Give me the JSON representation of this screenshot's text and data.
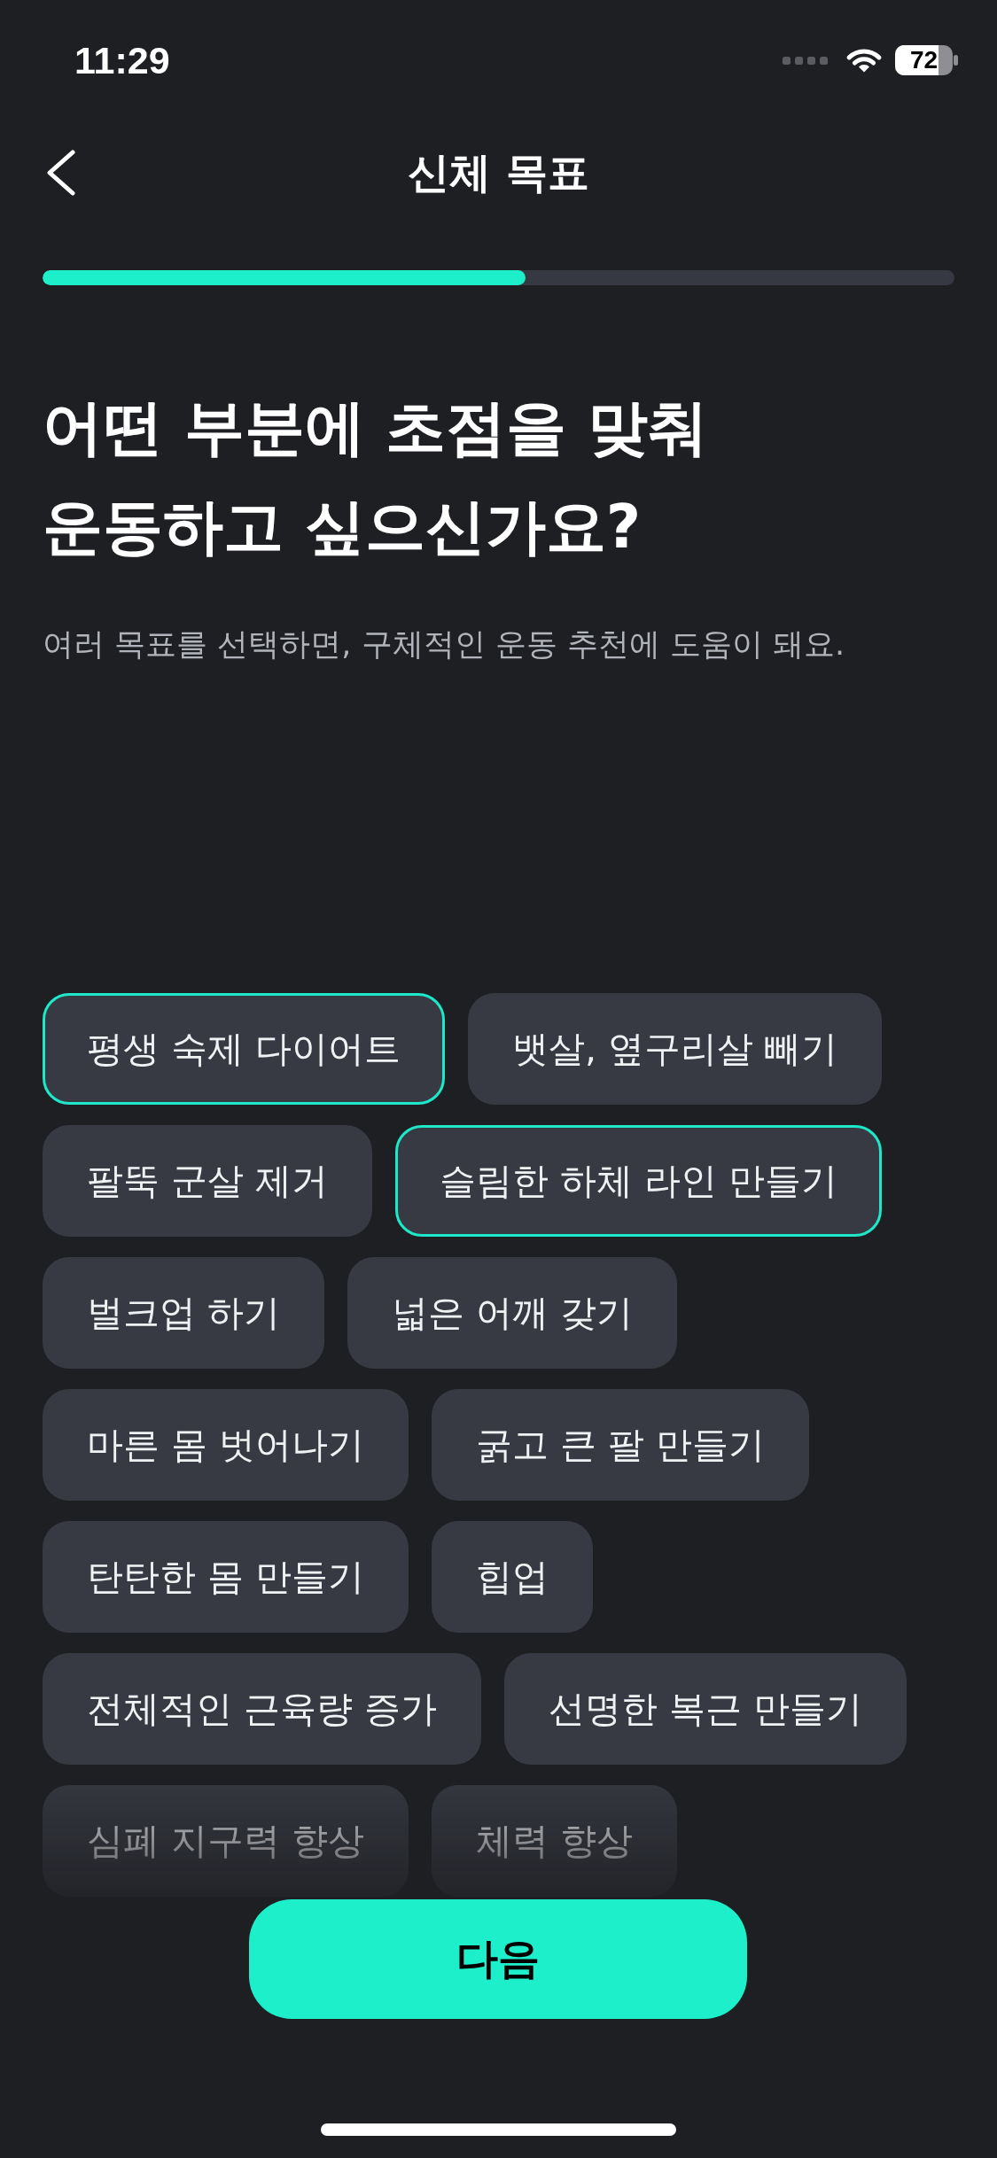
{
  "status_bar": {
    "time": "11:29",
    "battery": "72"
  },
  "nav": {
    "title": "신체 목표"
  },
  "progress": {
    "level": 0.53
  },
  "question": {
    "title_lines": [
      "어떤 부분에 초점을 맞춰",
      "운동하고 싶으신가요?"
    ],
    "subtitle": "여러 목표를 선택하면, 구체적인 운동 추천에 도움이 돼요."
  },
  "goals": [
    {
      "label": "평생 숙제 다이어트",
      "selected": true
    },
    {
      "label": "뱃살, 옆구리살 빼기",
      "selected": false
    },
    {
      "label": "팔뚝 군살 제거",
      "selected": false
    },
    {
      "label": "슬림한 하체 라인 만들기",
      "selected": true
    },
    {
      "label": "벌크업 하기",
      "selected": false
    },
    {
      "label": "넓은 어깨 갖기",
      "selected": false
    },
    {
      "label": "마른 몸 벗어나기",
      "selected": false
    },
    {
      "label": "굵고 큰 팔 만들기",
      "selected": false
    },
    {
      "label": "탄탄한 몸 만들기",
      "selected": false
    },
    {
      "label": "힙업",
      "selected": false
    },
    {
      "label": "전체적인 근육량 증가",
      "selected": false
    },
    {
      "label": "선명한 복근 만들기",
      "selected": false
    },
    {
      "label": "심폐 지구력 향상",
      "selected": false
    },
    {
      "label": "체력 향상",
      "selected": false
    }
  ],
  "next_button": {
    "label": "다음"
  }
}
